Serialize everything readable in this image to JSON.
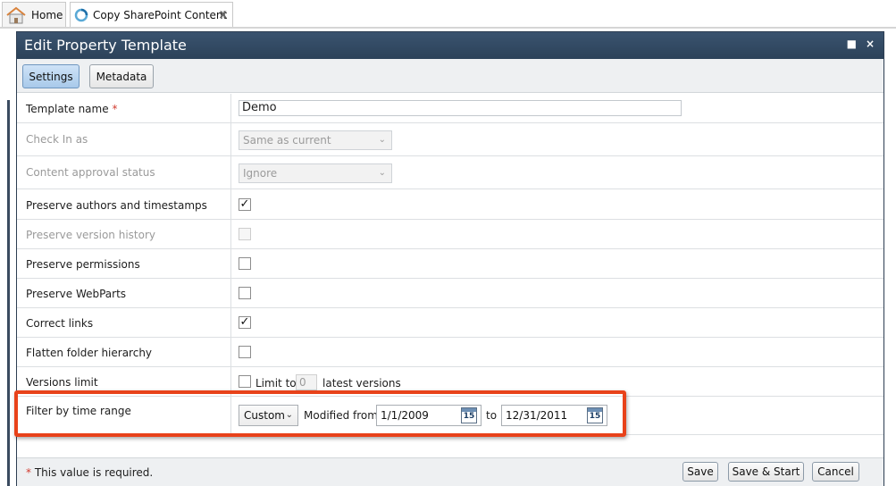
{
  "tabs": {
    "home": "Home",
    "active": "Copy SharePoint Content",
    "close": "x"
  },
  "dialog": {
    "title": "Edit Property Template",
    "maximize": "■",
    "close": "×"
  },
  "toolbar": {
    "settings": "Settings",
    "metadata": "Metadata"
  },
  "form": {
    "template_name_label": "Template name",
    "required_star": "*",
    "template_name_value": "Demo",
    "check_in_label": "Check In as",
    "check_in_value": "Same as current",
    "approval_label": "Content approval status",
    "approval_value": "Ignore",
    "preserve_authors_label": "Preserve authors and timestamps",
    "preserve_authors_checked": true,
    "preserve_version_label": "Preserve version history",
    "preserve_permissions_label": "Preserve permissions",
    "preserve_webparts_label": "Preserve WebParts",
    "correct_links_label": "Correct links",
    "correct_links_checked": true,
    "flatten_label": "Flatten folder hierarchy",
    "versions_label": "Versions limit",
    "limit_to": "Limit to",
    "limit_value": "0",
    "latest_versions": "latest versions",
    "filter_label": "Filter by time range",
    "filter_mode": "Custom",
    "modified_from": "Modified from",
    "from_date": "1/1/2009",
    "to": "to",
    "to_date": "12/31/2011",
    "calendar_day": "15"
  },
  "footer": {
    "required_note": " This value is required.",
    "save": "Save",
    "save_start": "Save & Start",
    "cancel": "Cancel"
  },
  "colors": {
    "titlebar": "#2f465e",
    "highlight": "#e8421a",
    "required": "#d23b2f"
  },
  "icons": [
    "home-icon",
    "loading-icon",
    "calendar-icon",
    "checkmark-icon"
  ]
}
